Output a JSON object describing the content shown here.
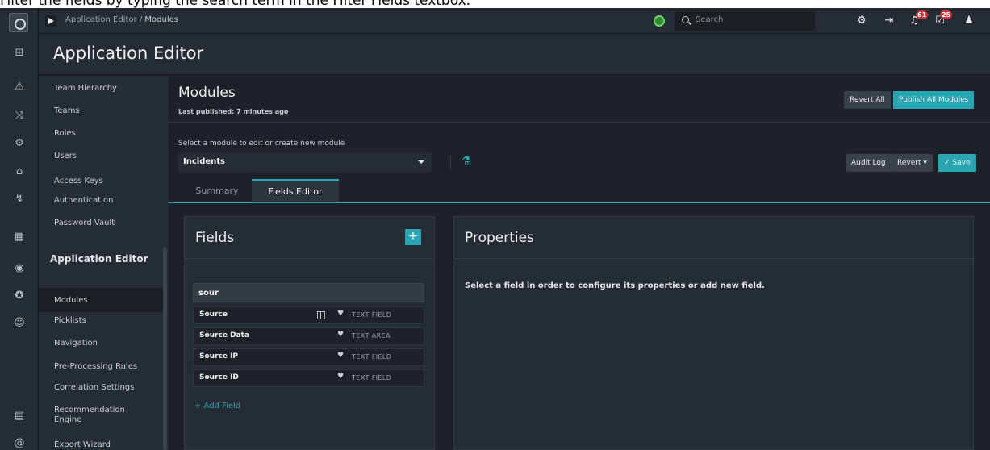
{
  "instruction": "Filter the fields by typing the search term in the Filter Fields textbox.",
  "topbar": {
    "breadcrumb_root": "Application Editor",
    "breadcrumb_sep": " / ",
    "breadcrumb_current": "Modules",
    "search_placeholder": "Search",
    "notifications_count": "61",
    "tasks_count": "25"
  },
  "page": {
    "title": "Application Editor"
  },
  "sidenav": {
    "items_top": [
      "Team Hierarchy",
      "Teams",
      "Roles",
      "Users",
      "Access Keys",
      "Authentication",
      "Password Vault"
    ],
    "section": "Application Editor",
    "items_bottom": [
      "Modules",
      "Picklists",
      "Navigation",
      "Pre-Processing Rules",
      "Correlation Settings",
      "Recommendation Engine",
      "Export Wizard"
    ],
    "active": "Modules"
  },
  "module": {
    "title": "Modules",
    "last_published": "Last published: 7 minutes ago",
    "revert_all": "Revert All",
    "publish_all": "Publish All Modules",
    "select_label": "Select a module to edit or create new module",
    "selected_module": "Incidents",
    "audit_log": "Audit Log",
    "revert": "Revert",
    "save": "Save"
  },
  "tabs": {
    "summary": "Summary",
    "fields_editor": "Fields Editor"
  },
  "fields_panel": {
    "title": "Fields",
    "add_button": "+",
    "filter_value": "sour",
    "rows": [
      {
        "name": "Source",
        "type": "TEXT FIELD"
      },
      {
        "name": "Source Data",
        "type": "TEXT AREA"
      },
      {
        "name": "Source IP",
        "type": "TEXT FIELD"
      },
      {
        "name": "Source ID",
        "type": "TEXT FIELD"
      }
    ],
    "add_field": "+ Add Field"
  },
  "properties_panel": {
    "title": "Properties",
    "message": "Select a field in order to configure its properties or add new field."
  },
  "colors": {
    "accent": "#2aa5b1",
    "background": "#1d2228",
    "panel": "#262c33",
    "badge": "#d22f3a"
  }
}
